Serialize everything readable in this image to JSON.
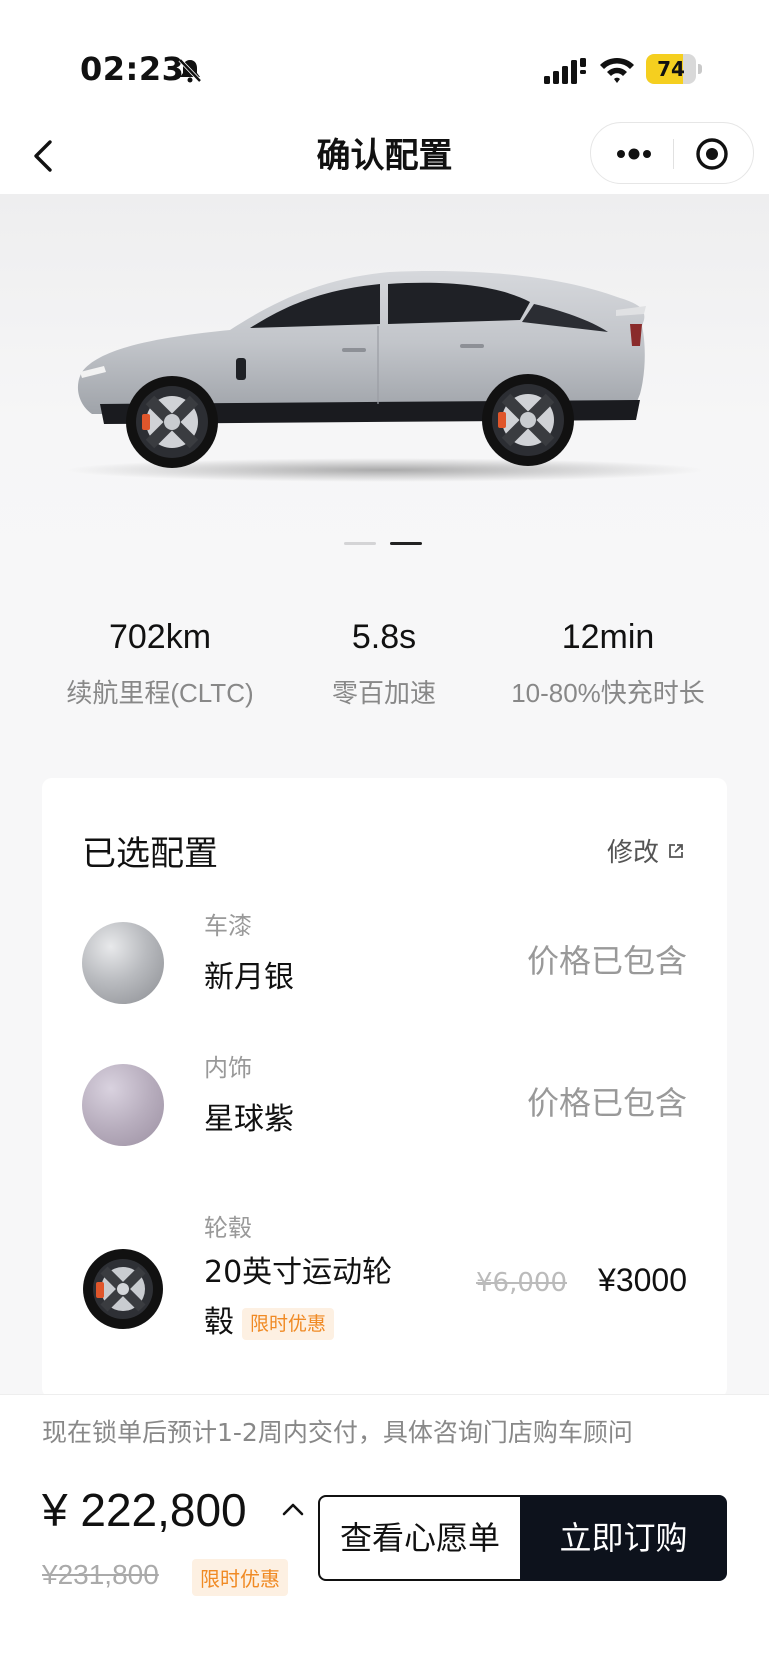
{
  "status_bar": {
    "time": "02:23",
    "battery": "74",
    "battery_level": 0.74
  },
  "nav": {
    "title": "确认配置"
  },
  "hero": {
    "pager_count": 2,
    "pager_active_index": 1
  },
  "specs": [
    {
      "value": "702km",
      "label": "续航里程(CLTC)"
    },
    {
      "value": "5.8s",
      "label": "零百加速"
    },
    {
      "value": "12min",
      "label": "10-80%快充时长"
    }
  ],
  "config": {
    "title": "已选配置",
    "edit_label": "修改",
    "items": [
      {
        "category": "车漆",
        "name": "新月银",
        "price": "价格已包含"
      },
      {
        "category": "内饰",
        "name": "星球紫",
        "price": "价格已包含"
      }
    ],
    "wheel": {
      "category": "轮毂",
      "name": "20英寸运动轮毂",
      "tag": "限时优惠",
      "original_price": "¥6,000",
      "price": "¥3000"
    }
  },
  "bottom": {
    "delivery_note": "现在锁单后预计1-2周内交付，具体咨询门店购车顾问",
    "price": "¥ 222,800",
    "original_price": "¥231,800",
    "promo_tag": "限时优惠",
    "wishlist_label": "查看心愿单",
    "buy_label": "立即订购"
  },
  "colors": {
    "accent_orange": "#f08a24",
    "buy_button": "#0d121c",
    "battery": "#f5cf1f"
  }
}
